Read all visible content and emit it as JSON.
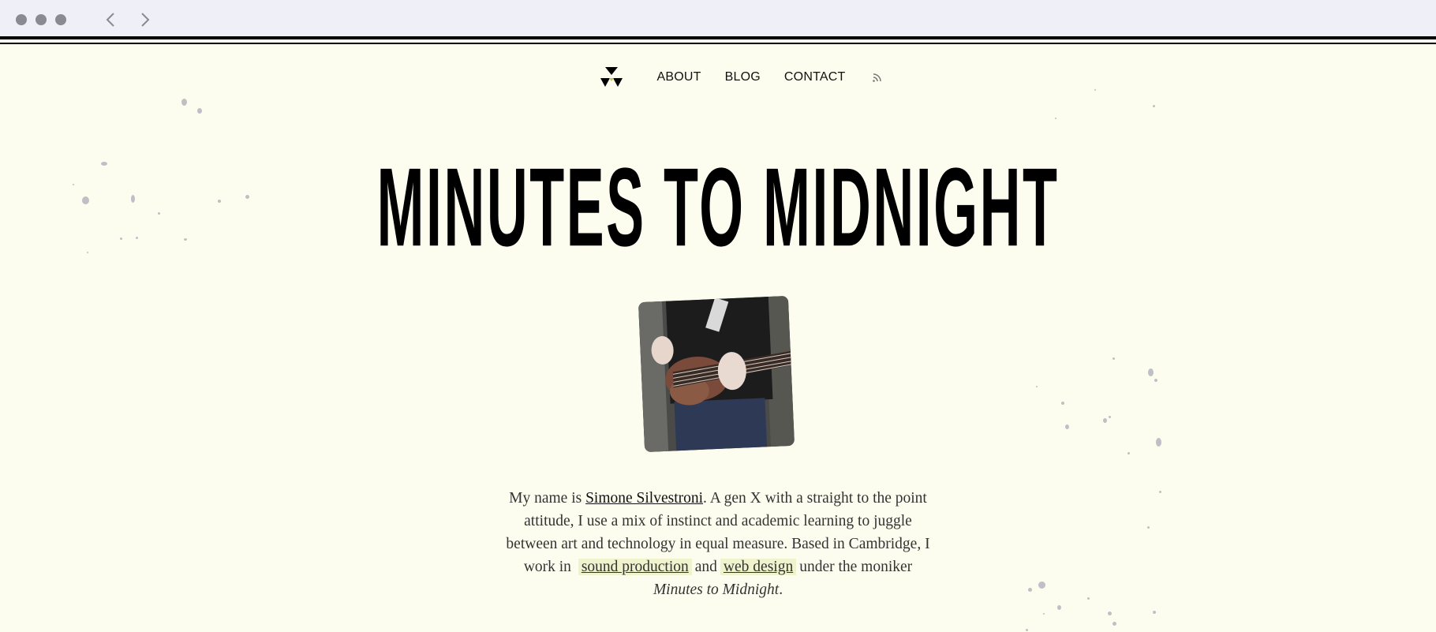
{
  "nav": {
    "about": "ABOUT",
    "blog": "BLOG",
    "contact": "CONTACT",
    "rss_icon": "rss-icon",
    "logo_icon": "tri-triangle-logo-icon"
  },
  "hero": {
    "title": "MINUTES TO MIDNIGHT"
  },
  "bio": {
    "intro": "My name is ",
    "name_link": "Simone Silvestroni",
    "text1": ". A gen X with a straight to the point attitude, I use a mix of instinct and academic learning to juggle between art and technology in equal measure. Based in Cambridge, I work in ",
    "link_sound": "sound production",
    "and_text": "and",
    "link_web": "web design",
    "text2": "under the moniker ",
    "moniker": "Minutes to Midnight",
    "end": "."
  },
  "colors": {
    "background": "#fdfdef",
    "chrome": "#efeff7",
    "highlight": "#f1f3cc"
  }
}
